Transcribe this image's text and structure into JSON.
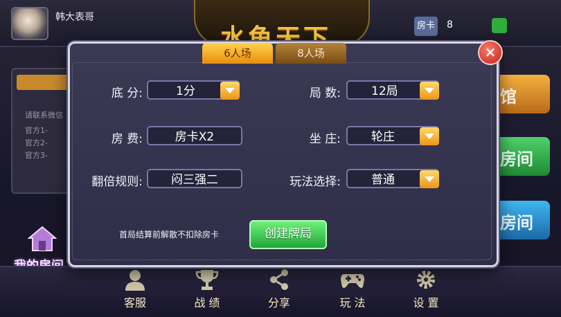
{
  "header": {
    "username": "韩大表哥",
    "logo": "水鱼天下",
    "room_card_label": "房卡",
    "room_card_count": "8"
  },
  "background_panel": {
    "lines": [
      "请联系微信",
      "官方1-",
      "官方2-",
      "官方3-"
    ]
  },
  "my_room_label": "我的房间",
  "right_buttons": [
    "馆",
    "房间",
    "房间"
  ],
  "bottom_nav": [
    {
      "label": "客服",
      "icon": "person-icon"
    },
    {
      "label": "战 绩",
      "icon": "trophy-icon"
    },
    {
      "label": "分享",
      "icon": "share-icon"
    },
    {
      "label": "玩 法",
      "icon": "gamepad-icon"
    },
    {
      "label": "设 置",
      "icon": "gear-icon"
    }
  ],
  "modal": {
    "tabs": [
      "6人场",
      "8人场"
    ],
    "active_tab": "6人场",
    "close_label": "×",
    "fields": {
      "base_score": {
        "label": "底 分:",
        "value": "1分"
      },
      "rounds": {
        "label": "局 数:",
        "value": "12局"
      },
      "room_fee": {
        "label": "房 费:",
        "value": "房卡X2"
      },
      "banker": {
        "label": "坐 庄:",
        "value": "轮庄"
      },
      "double_rule": {
        "label": "翻倍规则:",
        "value": "闷三强二"
      },
      "play_mode": {
        "label": "玩法选择:",
        "value": "普通"
      }
    },
    "note": "首局结算前解散不扣除房卡",
    "create_button": "创建牌局"
  },
  "colors": {
    "accent_orange": "#e88e10",
    "create_green": "#1fa63a",
    "close_red": "#c21f1f"
  }
}
